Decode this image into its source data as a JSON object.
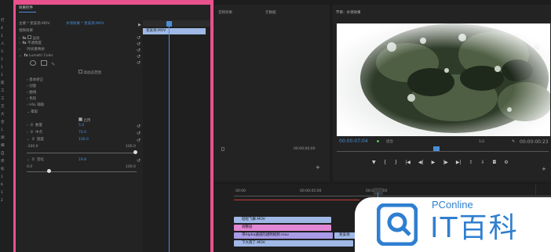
{
  "colors": {
    "accent": "#4a8fd8",
    "pink_frame": "#e8518e",
    "clip_blue": "#9fb8e6",
    "clip_pink": "#e287d4",
    "clip_purple": "#a99be6",
    "playhead": "#4a8fd8"
  },
  "left_strip": {
    "items": [
      "打",
      "4",
      "1",
      "人",
      "3",
      "1",
      "1",
      "1",
      "影",
      "工",
      "工",
      "方",
      "大",
      "合",
      "1",
      "调",
      "细",
      "自",
      "序",
      "标",
      "1",
      "6",
      "1",
      "2"
    ]
  },
  "effects_panel": {
    "title": "效果控件",
    "tab_source": "主要 * 芜美领.MOV",
    "tab_sequence": "水领效果 * 芜美领.MOV",
    "clip_name": "芜美领.MOV",
    "section_video": "视频效果",
    "fx_motion": "运动",
    "fx_opacity": "不透明度",
    "fx_time_remap": "时间重映射",
    "fx_lumetri": "Lumetri Color",
    "high_dynamic": "高动态范围",
    "basic": "基本矫正",
    "creative": "创意",
    "curves": "曲线",
    "color_wheels": "色轮",
    "hsl": "HSL 辅助",
    "vignette": "晕影",
    "enable_label": "启用",
    "amount_label": "数量",
    "amount_value": "5.0",
    "midpoint_label": "中点",
    "midpoint_value": "70.0",
    "roundness_label": "圆度",
    "roundness_value": "100.0",
    "range_min_a": "-100.0",
    "range_max_a": "100.0",
    "feather_label": "羽化",
    "feather_value": "19.8",
    "range_min_b": "0.0",
    "range_max_b": "100.0"
  },
  "source_panel": {
    "tab_a": "音频效果",
    "tab_b": "元数据",
    "timecode": "00;00;00;00"
  },
  "program_panel": {
    "title": "节目：水领效果",
    "timecode_left": "00:00:07:04",
    "fit": "适合",
    "quality": "1/2",
    "timecode_right": "00:00:00:23"
  },
  "timeline": {
    "ruler_a": "00:00",
    "ruler_b": "00:00:05:00",
    "ruler_c": "00:00:10:00",
    "clips": [
      {
        "label": "轻轻飞舞.MOV"
      },
      {
        "label": "调整层"
      },
      {
        "label": "带Alpha通道的透明视频.mov"
      },
      {
        "label": "芜美领"
      },
      {
        "label": "下大雨了.MOV"
      }
    ]
  },
  "watermark": {
    "brand": "PConline",
    "name": "IT百科"
  }
}
